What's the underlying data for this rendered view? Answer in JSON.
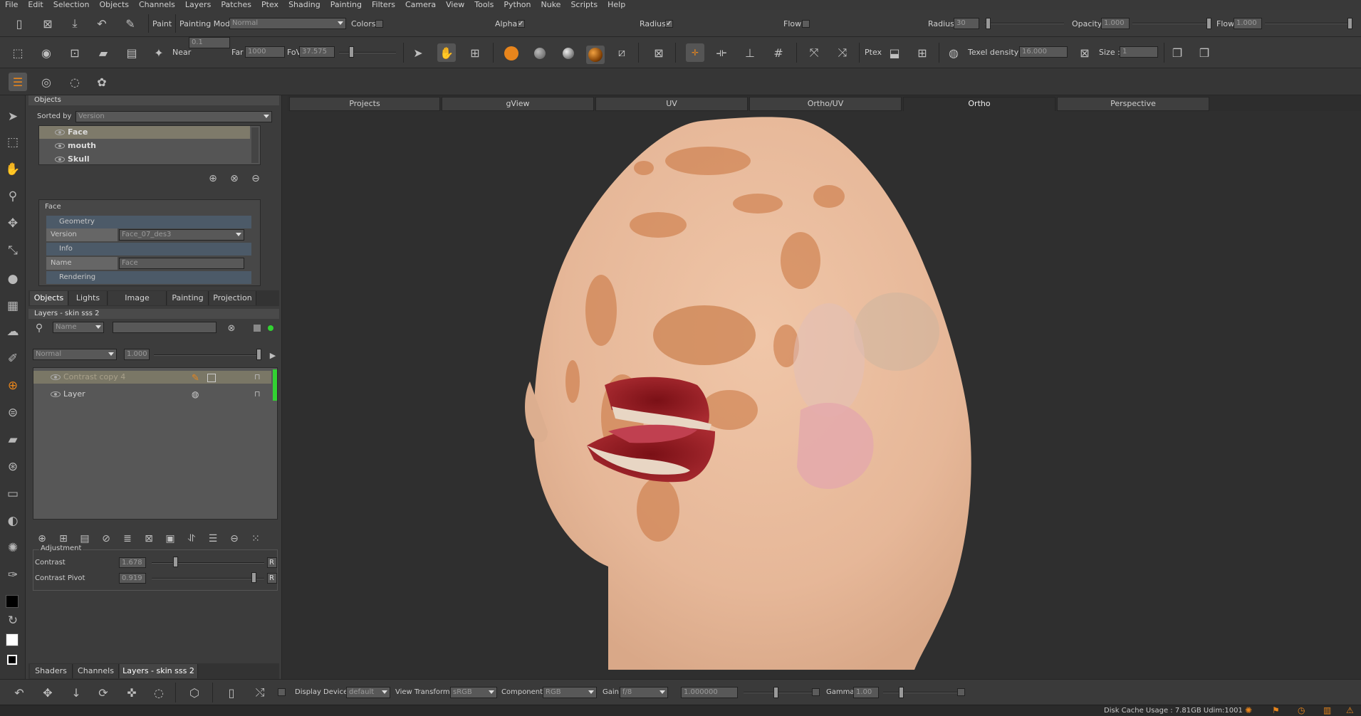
{
  "menu": [
    "File",
    "Edit",
    "Selection",
    "Objects",
    "Channels",
    "Layers",
    "Patches",
    "Ptex",
    "Shading",
    "Painting",
    "Filters",
    "Camera",
    "View",
    "Tools",
    "Python",
    "Nuke",
    "Scripts",
    "Help"
  ],
  "toolbar1": {
    "paint_label": "Paint",
    "painting_mode_label": "Painting Mode",
    "painting_mode_value": "Normal",
    "colors_label": "Colors",
    "alpha_label": "Alpha",
    "radius_check_label": "Radius",
    "flow_check_label": "Flow",
    "radius_label": "Radius",
    "radius_value": "30",
    "opacity_label": "Opacity",
    "opacity_value": "1.000",
    "flow_label": "Flow",
    "flow_value": "1.000"
  },
  "toolbar2": {
    "near_label": "Near",
    "near_value": "0.1",
    "far_label": "Far",
    "far_value": "1000",
    "fov_label": "FoV",
    "fov_value": "37.575",
    "ptex_label": "Ptex",
    "texel_label": "Texel density :",
    "texel_value": "16.000",
    "size_label": "Size :",
    "size_value": "1"
  },
  "objects_panel": {
    "title": "Objects",
    "sorted_by_label": "Sorted by",
    "sorted_by_value": "Version",
    "items": [
      {
        "name": "Face",
        "selected": true
      },
      {
        "name": "mouth",
        "selected": false
      },
      {
        "name": "Skull",
        "selected": false
      }
    ],
    "props_title": "Face",
    "geometry_label": "Geometry",
    "version_label": "Version",
    "version_value": "Face_07_des3",
    "info_label": "Info",
    "name_label": "Name",
    "name_value": "Face",
    "rendering_label": "Rendering"
  },
  "panel_tabs": [
    "Objects",
    "Lights",
    "Image Manager",
    "Painting",
    "Projection"
  ],
  "layers_panel": {
    "title": "Layers - skin sss 2",
    "filter_value": "Name",
    "blend_value": "Normal",
    "opacity_value": "1.000",
    "layers": [
      {
        "name": "Contrast copy 4",
        "selected": true
      },
      {
        "name": "Layer",
        "selected": false
      }
    ]
  },
  "adjustment": {
    "title": "Adjustment",
    "contrast_label": "Contrast",
    "contrast_value": "1.678",
    "pivot_label": "Contrast Pivot",
    "pivot_value": "0.919",
    "reset_label": "R"
  },
  "bottom_tabs": [
    "Shaders",
    "Channels",
    "Layers - skin sss 2"
  ],
  "view_tabs": [
    {
      "label": "Projects",
      "active": false
    },
    {
      "label": "gView",
      "active": false
    },
    {
      "label": "UV",
      "active": false
    },
    {
      "label": "Ortho/UV",
      "active": false
    },
    {
      "label": "Ortho",
      "active": true
    },
    {
      "label": "Perspective",
      "active": false
    }
  ],
  "bottom_bar": {
    "display_device_label": "Display Device",
    "display_device_value": "default",
    "view_transform_label": "View Transform",
    "view_transform_value": "sRGB",
    "component_label": "Component",
    "component_value": "RGB",
    "gain_label": "Gain",
    "gain_value": "f/8",
    "exposure_value": "1.000000",
    "gamma_label": "Gamma",
    "gamma_value": "1.00"
  },
  "status": {
    "text": "Disk Cache Usage : 7.81GB  Udim:1001"
  },
  "colors": {
    "accent": "#e8851c",
    "layer_green": "#32d232",
    "skin": "#e9bfa2"
  }
}
